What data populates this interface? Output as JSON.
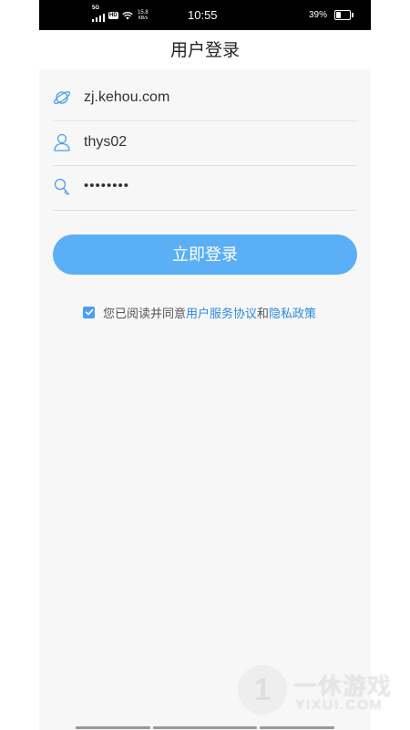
{
  "status_bar": {
    "network": "5G",
    "hd": "HD",
    "speed_value": "15.8",
    "speed_unit": "KB/s",
    "time": "10:55",
    "battery": "39%"
  },
  "header": {
    "title": "用户登录"
  },
  "form": {
    "server": {
      "value": "zj.kehou.com",
      "icon": "globe-icon"
    },
    "username": {
      "value": "thys02",
      "icon": "user-icon"
    },
    "password": {
      "masked_value": "••••••••",
      "icon": "key-icon"
    }
  },
  "login_button": {
    "label": "立即登录"
  },
  "agreement": {
    "checked": true,
    "prefix": "您已阅读并同意",
    "user_agreement": "用户服务协议",
    "and": "和",
    "privacy_policy": "隐私政策"
  },
  "colors": {
    "accent": "#5aaff7",
    "link": "#2a8ae8",
    "background": "#f7f7f7",
    "icon": "#4a9ef3"
  },
  "watermark": {
    "logo": "1",
    "name_cn": "一休游戏",
    "name_en": "YIXUI.COM"
  }
}
